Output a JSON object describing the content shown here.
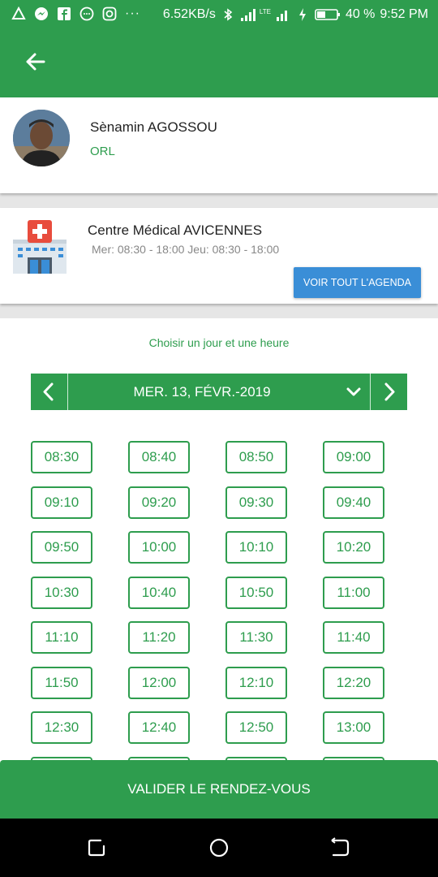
{
  "status_bar": {
    "network_speed": "6.52KB/s",
    "lte": "LTE",
    "battery": "40 %",
    "time": "9:52 PM",
    "more": "···"
  },
  "doctor": {
    "name": "Sènamin AGOSSOU",
    "specialty": "ORL"
  },
  "clinic": {
    "name": "Centre Médical AVICENNES",
    "hours": "Mer: 08:30 - 18:00 Jeu: 08:30 - 18:00",
    "agenda_button": "VOIR TOUT L'AGENDA"
  },
  "picker": {
    "label": "Choisir un jour et une heure",
    "date": "MER. 13, FÉVR.-2019"
  },
  "slots": [
    "08:30",
    "08:40",
    "08:50",
    "09:00",
    "09:10",
    "09:20",
    "09:30",
    "09:40",
    "09:50",
    "10:00",
    "10:10",
    "10:20",
    "10:30",
    "10:40",
    "10:50",
    "11:00",
    "11:10",
    "11:20",
    "11:30",
    "11:40",
    "11:50",
    "12:00",
    "12:10",
    "12:20",
    "12:30",
    "12:40",
    "12:50",
    "13:00"
  ],
  "validate_button": "VALIDER LE RENDEZ-VOUS",
  "colors": {
    "primary": "#2e9d4e",
    "accent_button": "#3a8ed7"
  }
}
